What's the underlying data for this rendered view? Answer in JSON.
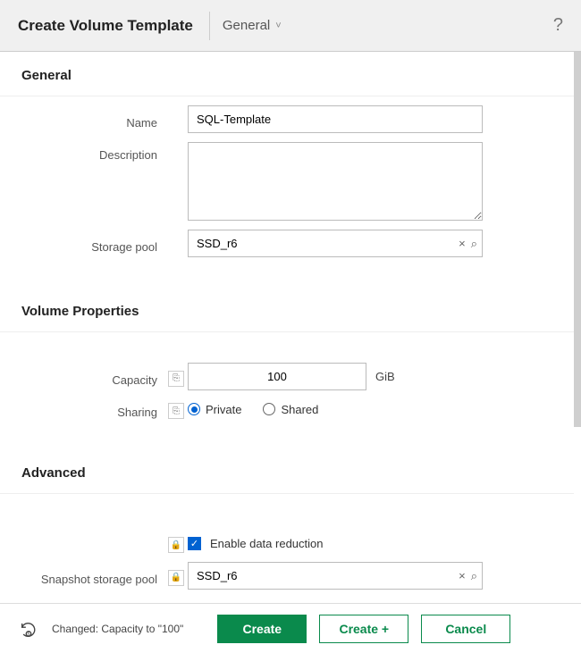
{
  "header": {
    "title": "Create Volume Template",
    "dropdown_label": "General",
    "help": "?"
  },
  "sections": {
    "general": {
      "heading": "General",
      "name_label": "Name",
      "name_value": "SQL-Template",
      "description_label": "Description",
      "description_value": "",
      "storage_pool_label": "Storage pool",
      "storage_pool_value": "SSD_r6"
    },
    "volume_properties": {
      "heading": "Volume Properties",
      "capacity_label": "Capacity",
      "capacity_value": "100",
      "capacity_unit": "GiB",
      "sharing_label": "Sharing",
      "sharing_private": "Private",
      "sharing_shared": "Shared"
    },
    "advanced": {
      "heading": "Advanced",
      "data_reduction_label": "Enable data reduction",
      "snapshot_pool_label": "Snapshot storage pool",
      "snapshot_pool_value": "SSD_r6"
    }
  },
  "footer": {
    "changed_text": "Changed: Capacity to \"100\"",
    "create": "Create",
    "create_plus": "Create +",
    "cancel": "Cancel"
  },
  "icons": {
    "clear": "×",
    "search": "⌕",
    "link": "⎘",
    "lock": "🔒",
    "check": "✓",
    "chev": "˅"
  }
}
